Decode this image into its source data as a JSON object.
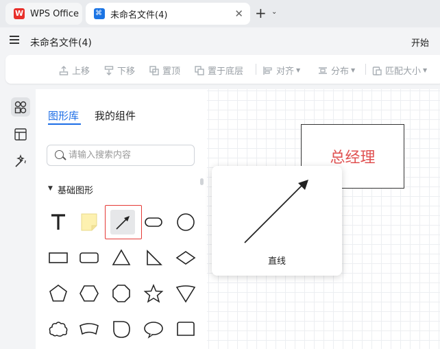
{
  "tabs": {
    "app_label": "WPS Office",
    "file_label": "未命名文件(4)"
  },
  "menu": {
    "doc_title": "未命名文件(4)",
    "start_label": "开始"
  },
  "toolbar": {
    "move_up": "上移",
    "move_down": "下移",
    "bring_front": "置顶",
    "send_back": "置于底层",
    "align": "对齐",
    "distribute": "分布",
    "match_size": "匹配大小"
  },
  "panel": {
    "tab_library": "图形库",
    "tab_mine": "我的组件",
    "search_placeholder": "请输入搜索内容",
    "category": "基础图形"
  },
  "canvas": {
    "node_text": "总经理"
  },
  "preview": {
    "label": "直线"
  },
  "colors": {
    "accent": "#1b6ce6",
    "selection": "#e53935",
    "node_text": "#e05252"
  },
  "icons": {
    "shapes": [
      "text-icon",
      "note-icon",
      "line-arrow-icon",
      "rounded-rect-icon",
      "circle-icon",
      "rect-icon",
      "rounded-rect-small-icon",
      "triangle-icon",
      "right-triangle-icon",
      "diamond-icon",
      "pentagon-icon",
      "hexagon-icon",
      "octagon-icon",
      "star-icon",
      "inverted-triangle-icon",
      "cloud-icon",
      "arc-band-icon",
      "drop-shape-icon",
      "ellipse-icon",
      "document-shape-icon"
    ]
  }
}
